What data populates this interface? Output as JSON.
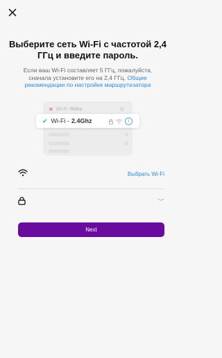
{
  "header": {
    "close_icon": "close-icon"
  },
  "main": {
    "title": "Выберите сеть Wi-Fi с частотой 2,4 ГГц и введите пароль.",
    "subtitle_text": "Если ваш Wi-Fi составляет 5 ГГц, пожалуйста, сначала установите его на 2,4 ГГц.",
    "subtitle_link": "Общие рекомендации по настройке маршрутизатора",
    "illustration": {
      "network_5g_prefix": "Wi-Fi - ",
      "network_5g_band": "5Ghz",
      "network_24_prefix": "Wi-Fi - ",
      "network_24_band": "2.4Ghz"
    },
    "wifi_field": {
      "icon": "wifi-icon",
      "select_label": "Выбрать Wi-Fi",
      "value": ""
    },
    "password_field": {
      "icon": "lock-icon",
      "value": "",
      "placeholder": ""
    },
    "next_label": "Next"
  },
  "colors": {
    "primary": "#6a0a9e",
    "link": "#2f8be8",
    "background": "#f6f6f6"
  }
}
